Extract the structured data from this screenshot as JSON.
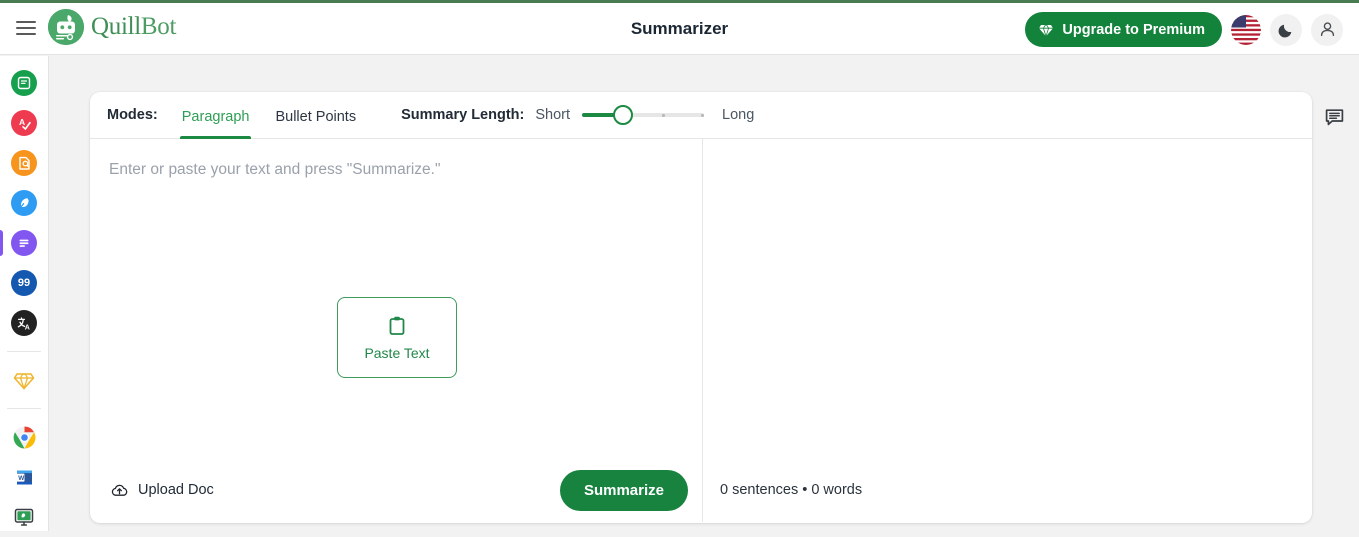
{
  "brand": {
    "name_part1": "Quill",
    "name_part2": "Bot",
    "logo_icon": "quillbot-robot-logo",
    "menu_icon": "hamburger-menu-icon"
  },
  "header": {
    "title": "Summarizer",
    "upgrade_label": "Upgrade to Premium",
    "upgrade_icon": "diamond-icon",
    "flag_icon": "us-flag-icon",
    "theme_icon": "moon-icon",
    "account_icon": "user-account-icon",
    "upgrade_bg": "#13823b"
  },
  "sidebar": {
    "items": [
      {
        "name": "paraphraser",
        "icon": "paraphraser-icon",
        "glyph": "↻",
        "color": "#16a04e",
        "active": false
      },
      {
        "name": "grammar-checker",
        "icon": "grammar-check-icon",
        "glyph": "A",
        "color": "#ef3b4f",
        "active": false
      },
      {
        "name": "plagiarism-checker",
        "icon": "plagiarism-search-icon",
        "glyph": "⌕",
        "color": "#f7941d",
        "active": false
      },
      {
        "name": "ai-writer",
        "icon": "ai-writer-pen-icon",
        "glyph": "✎",
        "color": "#2f9cf4",
        "active": false
      },
      {
        "name": "summarizer",
        "icon": "summarizer-lines-icon",
        "glyph": "☰",
        "color": "#8257f0",
        "active": true
      },
      {
        "name": "citation-generator",
        "icon": "quote-marks-icon",
        "glyph": "99",
        "color": "#1558b0",
        "active": false
      },
      {
        "name": "translator",
        "icon": "translate-icon",
        "glyph": "文",
        "color": "#222222",
        "active": false
      }
    ],
    "premium": {
      "name": "premium",
      "icon": "diamond-outline-icon",
      "color": "#f0b429"
    },
    "apps": [
      {
        "name": "chrome-extension",
        "icon": "chrome-icon"
      },
      {
        "name": "word-addin",
        "icon": "microsoft-word-icon"
      },
      {
        "name": "desktop-app",
        "icon": "desktop-app-icon"
      }
    ],
    "active_indicator_color": "#8257f0"
  },
  "toolbar": {
    "modes_label": "Modes:",
    "tabs": [
      {
        "label": "Paragraph",
        "active": true
      },
      {
        "label": "Bullet Points",
        "active": false
      }
    ],
    "summary_length_label": "Summary Length:",
    "short_label": "Short",
    "long_label": "Long",
    "slider_value": 1,
    "slider_max": 4,
    "slider_fill_color": "#1c8a42",
    "accent_color": "#1c8a42"
  },
  "editor": {
    "placeholder": "Enter or paste your text and press \"Summarize.\"",
    "paste_button_label": "Paste Text",
    "paste_button_icon": "clipboard-icon"
  },
  "footer": {
    "upload_label": "Upload Doc",
    "upload_icon": "cloud-upload-icon",
    "summarize_label": "Summarize",
    "counts_text": "0 sentences • 0 words"
  },
  "feedback": {
    "icon": "feedback-chat-icon"
  }
}
